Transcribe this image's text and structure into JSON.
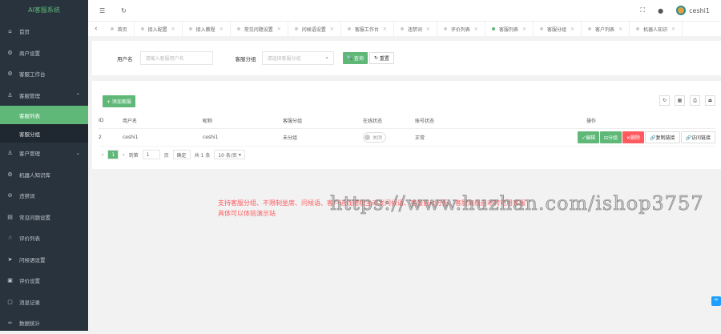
{
  "app": {
    "title": "AI客服系统"
  },
  "sidebar": {
    "items": [
      {
        "label": "首页",
        "icon": "home-icon",
        "glyph": "⌂"
      },
      {
        "label": "商户设置",
        "icon": "gear-icon",
        "glyph": "⚙"
      },
      {
        "label": "客服工作台",
        "icon": "desk-icon",
        "glyph": "⚙"
      },
      {
        "label": "客服管理",
        "icon": "user-icon",
        "glyph": "♙",
        "expanded": true,
        "children": [
          {
            "label": "客服列表",
            "active": true
          },
          {
            "label": "客服分组"
          }
        ]
      },
      {
        "label": "客户管理",
        "icon": "users-icon",
        "glyph": "♙"
      },
      {
        "label": "机器人知识库",
        "icon": "robot-icon",
        "glyph": "⚙"
      },
      {
        "label": "违禁词",
        "icon": "ban-icon",
        "glyph": "⊘"
      },
      {
        "label": "常见问题设置",
        "icon": "faq-icon",
        "glyph": "▤"
      },
      {
        "label": "评价列表",
        "icon": "thumb-icon",
        "glyph": "☝"
      },
      {
        "label": "问候语设置",
        "icon": "send-icon",
        "glyph": "➤"
      },
      {
        "label": "评价设置",
        "icon": "form-icon",
        "glyph": "▣"
      },
      {
        "label": "消息记录",
        "icon": "message-icon",
        "glyph": "▢"
      },
      {
        "label": "数据统计",
        "icon": "chart-icon",
        "glyph": "∞"
      }
    ]
  },
  "header": {
    "user": "ceshi1"
  },
  "tabs": [
    {
      "label": "首页",
      "closable": false
    },
    {
      "label": "接入配置"
    },
    {
      "label": "接入教程"
    },
    {
      "label": "常见问题设置"
    },
    {
      "label": "问候语设置"
    },
    {
      "label": "客服工作台"
    },
    {
      "label": "违禁词"
    },
    {
      "label": "评价列表"
    },
    {
      "label": "客服列表",
      "active": true
    },
    {
      "label": "客服分组"
    },
    {
      "label": "客户列表"
    },
    {
      "label": "机器人知识"
    }
  ],
  "search": {
    "username_label": "用户名",
    "username_placeholder": "请输入客服用户名",
    "group_label": "客服分组",
    "group_placeholder": "请选择客服分组",
    "query": "查询",
    "reset": "重置"
  },
  "table": {
    "add_button": "+ 添加客服",
    "columns": [
      "ID",
      "用户名",
      "昵称",
      "客服分组",
      "在线状态",
      "账号状态",
      "操作"
    ],
    "rows": [
      {
        "id": "2",
        "username": "ceshi1",
        "nickname": "ceshi1",
        "group": "未分组",
        "online": "关闭",
        "status": "正常"
      }
    ],
    "actions": [
      "✓编辑",
      "⊟分组",
      "✕删除",
      "🔗复制链接",
      "🔗访问链接"
    ]
  },
  "pagination": {
    "current": "1",
    "goto_label": "到第",
    "goto_value": "1",
    "page_unit": "页",
    "confirm": "确定",
    "total": "共 1 条",
    "page_size": "10 条/页"
  },
  "notice": {
    "line1": "支持客服分组、不限制坐席、问候语、客户进线随机主动发问候语、客服自动分配、客服离线自动转可用客服",
    "line2": "具体可以体验演示站"
  },
  "watermark": "https://www.huzhan.com/ishop3757"
}
